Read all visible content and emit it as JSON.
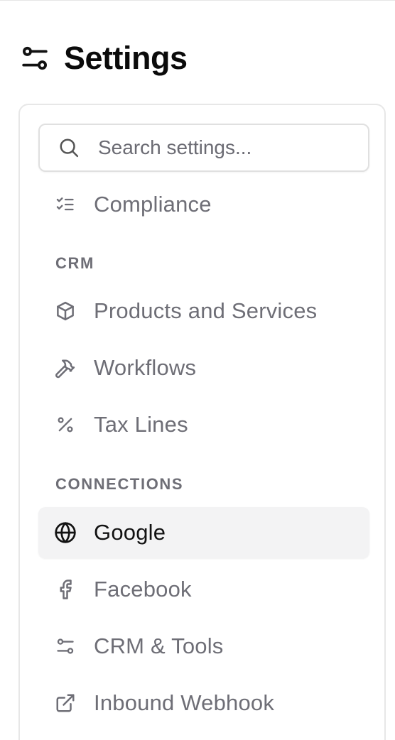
{
  "header": {
    "title": "Settings",
    "icon": "settings-sliders-icon"
  },
  "search": {
    "placeholder": "Search settings...",
    "value": "",
    "icon": "search-icon"
  },
  "nav": {
    "top_items": [
      {
        "label": "Compliance",
        "icon": "list-checks-icon"
      }
    ],
    "sections": [
      {
        "title": "CRM",
        "items": [
          {
            "label": "Products and Services",
            "icon": "box-icon"
          },
          {
            "label": "Workflows",
            "icon": "hammer-icon"
          },
          {
            "label": "Tax Lines",
            "icon": "percent-icon"
          }
        ]
      },
      {
        "title": "CONNECTIONS",
        "items": [
          {
            "label": "Google",
            "icon": "globe-icon",
            "active": true
          },
          {
            "label": "Facebook",
            "icon": "facebook-icon"
          },
          {
            "label": "CRM & Tools",
            "icon": "sliders-icon"
          },
          {
            "label": "Inbound Webhook",
            "icon": "external-link-icon"
          }
        ]
      }
    ]
  },
  "colors": {
    "text_primary": "#111111",
    "text_muted": "#6e6e76",
    "border": "#e7e7e7",
    "active_bg": "#f3f3f4"
  }
}
